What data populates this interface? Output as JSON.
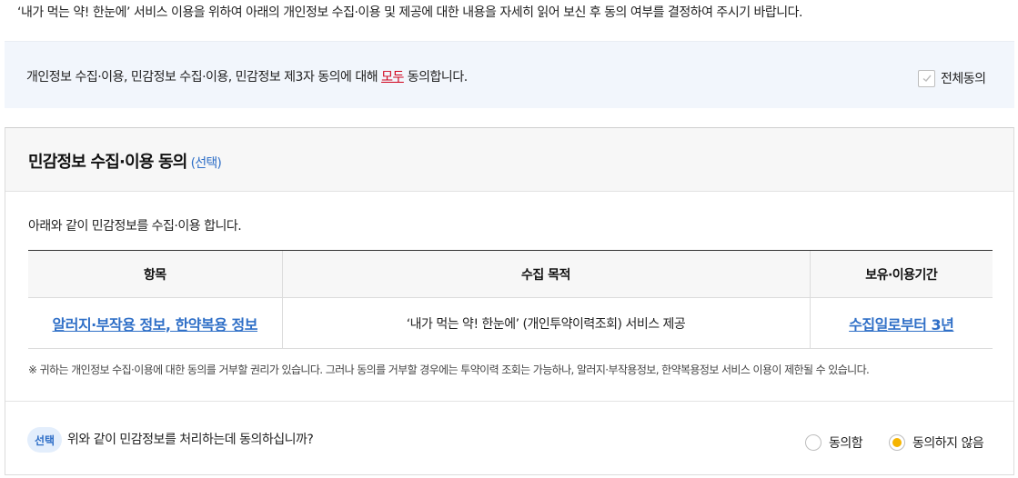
{
  "intro": "‘내가 먹는 약! 한눈에’ 서비스 이용을 위하여 아래의 개인정보 수집·이용 및 제공에 대한 내용을 자세히 읽어 보신 후 동의 여부를 결정하여 주시기 바랍니다.",
  "all_agree": {
    "text_before": "개인정보 수집·이용, 민감정보 수집·이용, 민감정보 제3자 동의에 대해 ",
    "highlight": "모두",
    "text_after": " 동의합니다.",
    "checkbox_label": "전체동의",
    "checked": true
  },
  "section": {
    "title": "민감정보 수집·이용 동의",
    "optional_tag": "(선택)",
    "description": "아래와 같이 민감정보를 수집·이용 합니다.",
    "table": {
      "headers": [
        "항목",
        "수집 목적",
        "보유·이용기간"
      ],
      "row": {
        "item": "알러지·부작용 정보, 한약복용 정보",
        "purpose": "‘내가 먹는 약! 한눈에’ (개인투약이력조회) 서비스 제공",
        "period": "수집일로부터 3년"
      }
    },
    "note": "※ 귀하는 개인정보 수집·이용에 대한 동의를 거부할 권리가 있습니다. 그러나 동의를 거부할 경우에는 투약이력 조회는 가능하나, 알러지·부작용정보, 한약복용정보 서비스 이용이 제한될 수 있습니다.",
    "question": {
      "badge": "선택",
      "text": "위와 같이 민감정보를 처리하는데 동의하십니까?",
      "options": [
        "동의함",
        "동의하지 않음"
      ],
      "selected": "동의하지 않음"
    }
  },
  "colors": {
    "accent": "#2f6fc7",
    "highlight": "#d0021b",
    "radio_selected": "#f5b400",
    "panel_bg": "#f2f6fc"
  }
}
